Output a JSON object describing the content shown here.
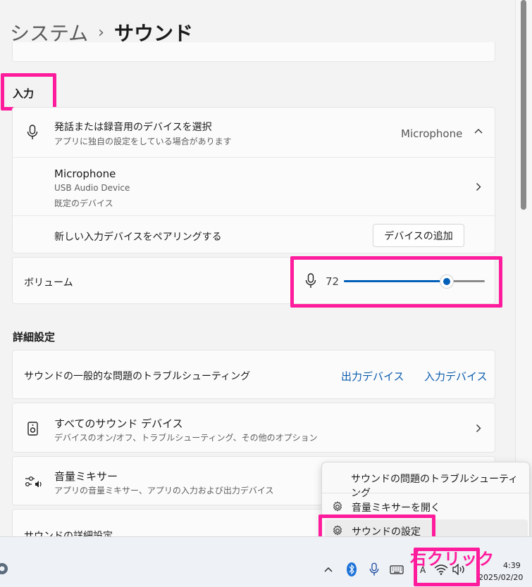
{
  "breadcrumb": {
    "parent": "システム",
    "separator": "›",
    "current": "サウンド"
  },
  "input_section": {
    "title": "入力",
    "device_select": {
      "title": "発話または録音用のデバイスを選択",
      "subtitle": "アプリに独自の設定をしている場合があります",
      "value": "Microphone"
    },
    "device": {
      "name": "Microphone",
      "type": "USB Audio Device",
      "status": "既定のデバイス"
    },
    "pair": {
      "label": "新しい入力デバイスをペアリングする",
      "button": "デバイスの追加"
    },
    "volume": {
      "label": "ボリューム",
      "value": "72",
      "level_percent": 72
    }
  },
  "advanced": {
    "title": "詳細設定",
    "troubleshoot": {
      "label": "サウンドの一般的な問題のトラブルシューティング",
      "output_link": "出力デバイス",
      "input_link": "入力デバイス"
    },
    "all_devices": {
      "title": "すべてのサウンド デバイス",
      "subtitle": "デバイスのオン/オフ、トラブルシューティング、その他のオプション"
    },
    "mixer": {
      "title": "音量ミキサー",
      "subtitle": "アプリの音量ミキサー、アプリの入力および出力デバイス"
    },
    "more": {
      "title": "サウンドの詳細設定"
    }
  },
  "context_menu": {
    "items": [
      "サウンドの問題のトラブルシューティング",
      "音量ミキサーを開く",
      "サウンドの設定"
    ]
  },
  "annotation": {
    "text": "右クリック"
  },
  "taskbar": {
    "time": "4:39",
    "date": "2025/02/20"
  },
  "colors": {
    "accent": "#005fb8",
    "highlight": "#ff1c9c",
    "background": "#f3f3f3"
  }
}
